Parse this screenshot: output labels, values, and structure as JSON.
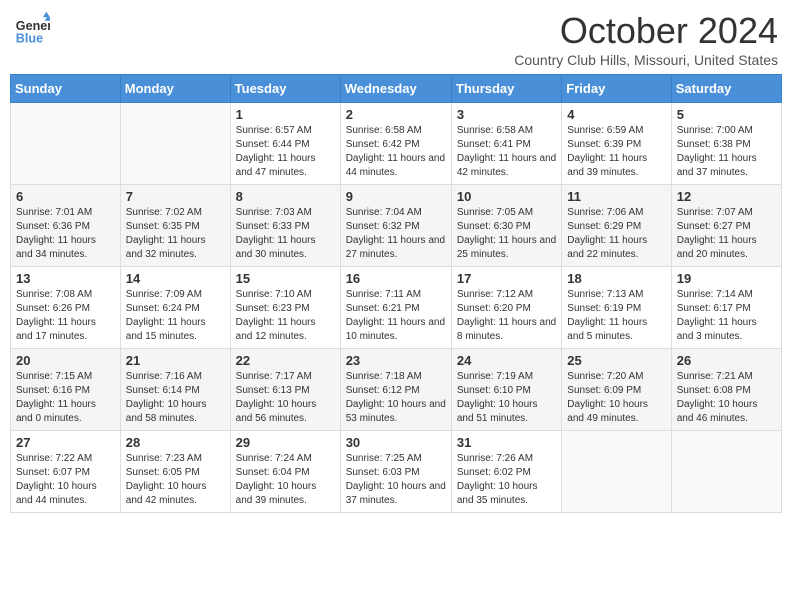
{
  "logo": {
    "general": "General",
    "blue": "Blue"
  },
  "header": {
    "month": "October 2024",
    "location": "Country Club Hills, Missouri, United States"
  },
  "days_of_week": [
    "Sunday",
    "Monday",
    "Tuesday",
    "Wednesday",
    "Thursday",
    "Friday",
    "Saturday"
  ],
  "weeks": [
    [
      {
        "day": "",
        "sunrise": "",
        "sunset": "",
        "daylight": ""
      },
      {
        "day": "",
        "sunrise": "",
        "sunset": "",
        "daylight": ""
      },
      {
        "day": "1",
        "sunrise": "Sunrise: 6:57 AM",
        "sunset": "Sunset: 6:44 PM",
        "daylight": "Daylight: 11 hours and 47 minutes."
      },
      {
        "day": "2",
        "sunrise": "Sunrise: 6:58 AM",
        "sunset": "Sunset: 6:42 PM",
        "daylight": "Daylight: 11 hours and 44 minutes."
      },
      {
        "day": "3",
        "sunrise": "Sunrise: 6:58 AM",
        "sunset": "Sunset: 6:41 PM",
        "daylight": "Daylight: 11 hours and 42 minutes."
      },
      {
        "day": "4",
        "sunrise": "Sunrise: 6:59 AM",
        "sunset": "Sunset: 6:39 PM",
        "daylight": "Daylight: 11 hours and 39 minutes."
      },
      {
        "day": "5",
        "sunrise": "Sunrise: 7:00 AM",
        "sunset": "Sunset: 6:38 PM",
        "daylight": "Daylight: 11 hours and 37 minutes."
      }
    ],
    [
      {
        "day": "6",
        "sunrise": "Sunrise: 7:01 AM",
        "sunset": "Sunset: 6:36 PM",
        "daylight": "Daylight: 11 hours and 34 minutes."
      },
      {
        "day": "7",
        "sunrise": "Sunrise: 7:02 AM",
        "sunset": "Sunset: 6:35 PM",
        "daylight": "Daylight: 11 hours and 32 minutes."
      },
      {
        "day": "8",
        "sunrise": "Sunrise: 7:03 AM",
        "sunset": "Sunset: 6:33 PM",
        "daylight": "Daylight: 11 hours and 30 minutes."
      },
      {
        "day": "9",
        "sunrise": "Sunrise: 7:04 AM",
        "sunset": "Sunset: 6:32 PM",
        "daylight": "Daylight: 11 hours and 27 minutes."
      },
      {
        "day": "10",
        "sunrise": "Sunrise: 7:05 AM",
        "sunset": "Sunset: 6:30 PM",
        "daylight": "Daylight: 11 hours and 25 minutes."
      },
      {
        "day": "11",
        "sunrise": "Sunrise: 7:06 AM",
        "sunset": "Sunset: 6:29 PM",
        "daylight": "Daylight: 11 hours and 22 minutes."
      },
      {
        "day": "12",
        "sunrise": "Sunrise: 7:07 AM",
        "sunset": "Sunset: 6:27 PM",
        "daylight": "Daylight: 11 hours and 20 minutes."
      }
    ],
    [
      {
        "day": "13",
        "sunrise": "Sunrise: 7:08 AM",
        "sunset": "Sunset: 6:26 PM",
        "daylight": "Daylight: 11 hours and 17 minutes."
      },
      {
        "day": "14",
        "sunrise": "Sunrise: 7:09 AM",
        "sunset": "Sunset: 6:24 PM",
        "daylight": "Daylight: 11 hours and 15 minutes."
      },
      {
        "day": "15",
        "sunrise": "Sunrise: 7:10 AM",
        "sunset": "Sunset: 6:23 PM",
        "daylight": "Daylight: 11 hours and 12 minutes."
      },
      {
        "day": "16",
        "sunrise": "Sunrise: 7:11 AM",
        "sunset": "Sunset: 6:21 PM",
        "daylight": "Daylight: 11 hours and 10 minutes."
      },
      {
        "day": "17",
        "sunrise": "Sunrise: 7:12 AM",
        "sunset": "Sunset: 6:20 PM",
        "daylight": "Daylight: 11 hours and 8 minutes."
      },
      {
        "day": "18",
        "sunrise": "Sunrise: 7:13 AM",
        "sunset": "Sunset: 6:19 PM",
        "daylight": "Daylight: 11 hours and 5 minutes."
      },
      {
        "day": "19",
        "sunrise": "Sunrise: 7:14 AM",
        "sunset": "Sunset: 6:17 PM",
        "daylight": "Daylight: 11 hours and 3 minutes."
      }
    ],
    [
      {
        "day": "20",
        "sunrise": "Sunrise: 7:15 AM",
        "sunset": "Sunset: 6:16 PM",
        "daylight": "Daylight: 11 hours and 0 minutes."
      },
      {
        "day": "21",
        "sunrise": "Sunrise: 7:16 AM",
        "sunset": "Sunset: 6:14 PM",
        "daylight": "Daylight: 10 hours and 58 minutes."
      },
      {
        "day": "22",
        "sunrise": "Sunrise: 7:17 AM",
        "sunset": "Sunset: 6:13 PM",
        "daylight": "Daylight: 10 hours and 56 minutes."
      },
      {
        "day": "23",
        "sunrise": "Sunrise: 7:18 AM",
        "sunset": "Sunset: 6:12 PM",
        "daylight": "Daylight: 10 hours and 53 minutes."
      },
      {
        "day": "24",
        "sunrise": "Sunrise: 7:19 AM",
        "sunset": "Sunset: 6:10 PM",
        "daylight": "Daylight: 10 hours and 51 minutes."
      },
      {
        "day": "25",
        "sunrise": "Sunrise: 7:20 AM",
        "sunset": "Sunset: 6:09 PM",
        "daylight": "Daylight: 10 hours and 49 minutes."
      },
      {
        "day": "26",
        "sunrise": "Sunrise: 7:21 AM",
        "sunset": "Sunset: 6:08 PM",
        "daylight": "Daylight: 10 hours and 46 minutes."
      }
    ],
    [
      {
        "day": "27",
        "sunrise": "Sunrise: 7:22 AM",
        "sunset": "Sunset: 6:07 PM",
        "daylight": "Daylight: 10 hours and 44 minutes."
      },
      {
        "day": "28",
        "sunrise": "Sunrise: 7:23 AM",
        "sunset": "Sunset: 6:05 PM",
        "daylight": "Daylight: 10 hours and 42 minutes."
      },
      {
        "day": "29",
        "sunrise": "Sunrise: 7:24 AM",
        "sunset": "Sunset: 6:04 PM",
        "daylight": "Daylight: 10 hours and 39 minutes."
      },
      {
        "day": "30",
        "sunrise": "Sunrise: 7:25 AM",
        "sunset": "Sunset: 6:03 PM",
        "daylight": "Daylight: 10 hours and 37 minutes."
      },
      {
        "day": "31",
        "sunrise": "Sunrise: 7:26 AM",
        "sunset": "Sunset: 6:02 PM",
        "daylight": "Daylight: 10 hours and 35 minutes."
      },
      {
        "day": "",
        "sunrise": "",
        "sunset": "",
        "daylight": ""
      },
      {
        "day": "",
        "sunrise": "",
        "sunset": "",
        "daylight": ""
      }
    ]
  ]
}
